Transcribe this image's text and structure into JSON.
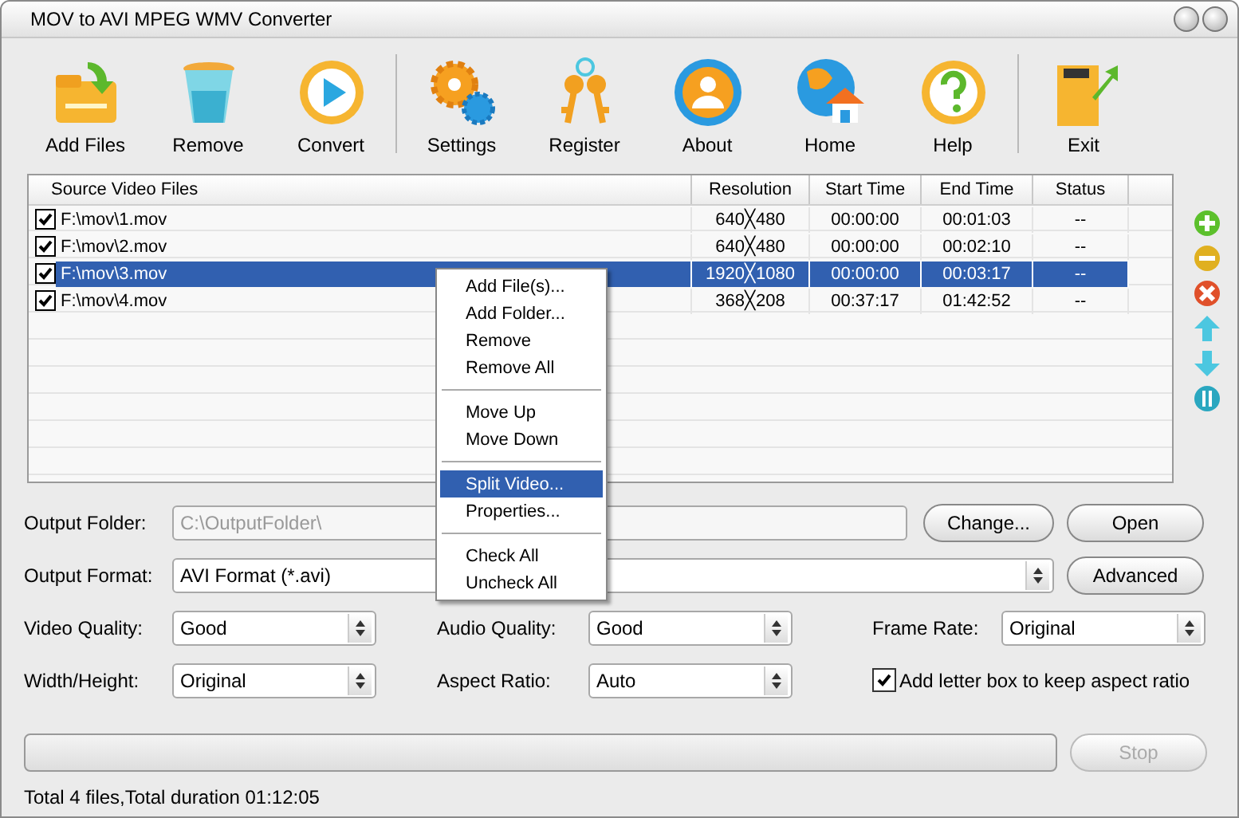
{
  "window": {
    "title": "MOV to AVI MPEG WMV Converter"
  },
  "toolbar": {
    "groups": [
      {
        "items": [
          {
            "label": "Add Files",
            "kind": "add"
          },
          {
            "label": "Remove",
            "kind": "remove"
          },
          {
            "label": "Convert",
            "kind": "convert"
          }
        ]
      },
      {
        "items": [
          {
            "label": "Settings",
            "kind": "settings"
          },
          {
            "label": "Register",
            "kind": "register"
          },
          {
            "label": "About",
            "kind": "about"
          },
          {
            "label": "Home",
            "kind": "home"
          },
          {
            "label": "Help",
            "kind": "help"
          }
        ]
      },
      {
        "items": [
          {
            "label": "Exit",
            "kind": "exit"
          }
        ]
      }
    ]
  },
  "file_list": {
    "columns": [
      "Source Video Files",
      "Resolution",
      "Start Time",
      "End Time",
      "Status"
    ],
    "rows": [
      {
        "checked": true,
        "selected": false,
        "cells": [
          "F:\\mov\\1.mov",
          "640╳480",
          "00:00:00",
          "00:01:03",
          "--"
        ]
      },
      {
        "checked": true,
        "selected": false,
        "cells": [
          "F:\\mov\\2.mov",
          "640╳480",
          "00:00:00",
          "00:02:10",
          "--"
        ]
      },
      {
        "checked": true,
        "selected": true,
        "cells": [
          "F:\\mov\\3.mov",
          "1920╳1080",
          "00:00:00",
          "00:03:17",
          "--"
        ]
      },
      {
        "checked": true,
        "selected": false,
        "cells": [
          "F:\\mov\\4.mov",
          "368╳208",
          "00:37:17",
          "01:42:52",
          "--"
        ]
      }
    ]
  },
  "side_tools": [
    {
      "kind": "add"
    },
    {
      "kind": "remove"
    },
    {
      "kind": "clear"
    },
    {
      "kind": "up"
    },
    {
      "kind": "down"
    },
    {
      "kind": "split"
    }
  ],
  "context_menu": {
    "groups": [
      {
        "items": [
          {
            "label": "Add File(s)...",
            "selected": false
          },
          {
            "label": "Add Folder...",
            "selected": false
          },
          {
            "label": "Remove",
            "selected": false
          },
          {
            "label": "Remove All",
            "selected": false
          }
        ]
      },
      {
        "items": [
          {
            "label": "Move Up",
            "selected": false
          },
          {
            "label": "Move Down",
            "selected": false
          }
        ]
      },
      {
        "items": [
          {
            "label": "Split Video...",
            "selected": true
          },
          {
            "label": "Properties...",
            "selected": false
          }
        ]
      },
      {
        "items": [
          {
            "label": "Check All",
            "selected": false
          },
          {
            "label": "Uncheck All",
            "selected": false
          }
        ]
      }
    ]
  },
  "output_folder": {
    "label": "Output Folder:",
    "value": "C:\\OutputFolder\\",
    "disabled": true,
    "buttons": [
      "Change...",
      "Open"
    ]
  },
  "output_format": {
    "label": "Output Format:",
    "value": "AVI Format (*.avi)",
    "button": "Advanced"
  },
  "settings": [
    {
      "label": "Video Quality:",
      "value": "Good"
    },
    {
      "label": "Audio Quality:",
      "value": "Good"
    },
    {
      "label": "Frame Rate:",
      "value": "Original"
    },
    {
      "label": "Width/Height:",
      "value": "Original"
    },
    {
      "label": "Aspect Ratio:",
      "value": "Auto"
    }
  ],
  "letterbox": {
    "label": "Add letter box to keep aspect ratio",
    "checked": true
  },
  "progress": {
    "level": 0
  },
  "stop_button": {
    "label": "Stop",
    "disabled": true
  },
  "status_bar": {
    "text": "Total 4 files,Total duration 01:12:05"
  }
}
